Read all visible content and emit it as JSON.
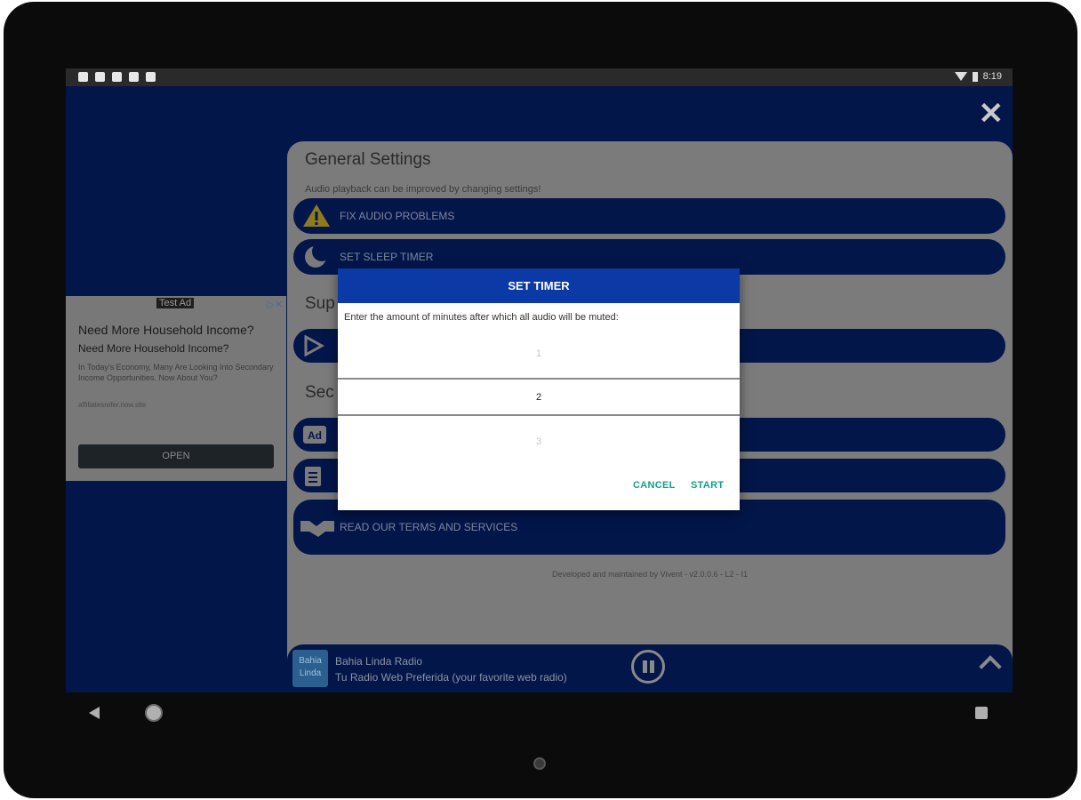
{
  "status_bar": {
    "time": "8:19"
  },
  "ad": {
    "tag": "Test Ad",
    "headline": "Need More Household Income?",
    "subheadline": "Need More Household Income?",
    "body": "In Today's Economy, Many Are Looking Into Secondary Income Opportunities. Now About You?",
    "url": "affiliatesrefer.now.site",
    "button": "OPEN"
  },
  "settings": {
    "title": "General Settings",
    "subtitle": "Audio playback can be improved by changing settings!",
    "items": [
      {
        "label": "FIX AUDIO PROBLEMS",
        "icon": "warning-icon"
      },
      {
        "label": "SET SLEEP TIMER",
        "icon": "moon-icon"
      }
    ],
    "section2_fragment": "Sup",
    "section3_fragment": "Sec",
    "terms_label": "READ OUR TERMS AND SERVICES",
    "footer": "Developed and maintained by Vivent - v2.0.0.6 - L2 - I1"
  },
  "player": {
    "logo_text": "Bahia Linda",
    "station": "Bahia Linda Radio",
    "tagline": "Tu Radio Web Preferida (your favorite web radio)"
  },
  "dialog": {
    "title": "SET TIMER",
    "message": "Enter the amount of minutes after which all audio will be muted:",
    "picker": {
      "prev": "1",
      "selected": "2",
      "next": "3"
    },
    "cancel": "CANCEL",
    "start": "START"
  }
}
